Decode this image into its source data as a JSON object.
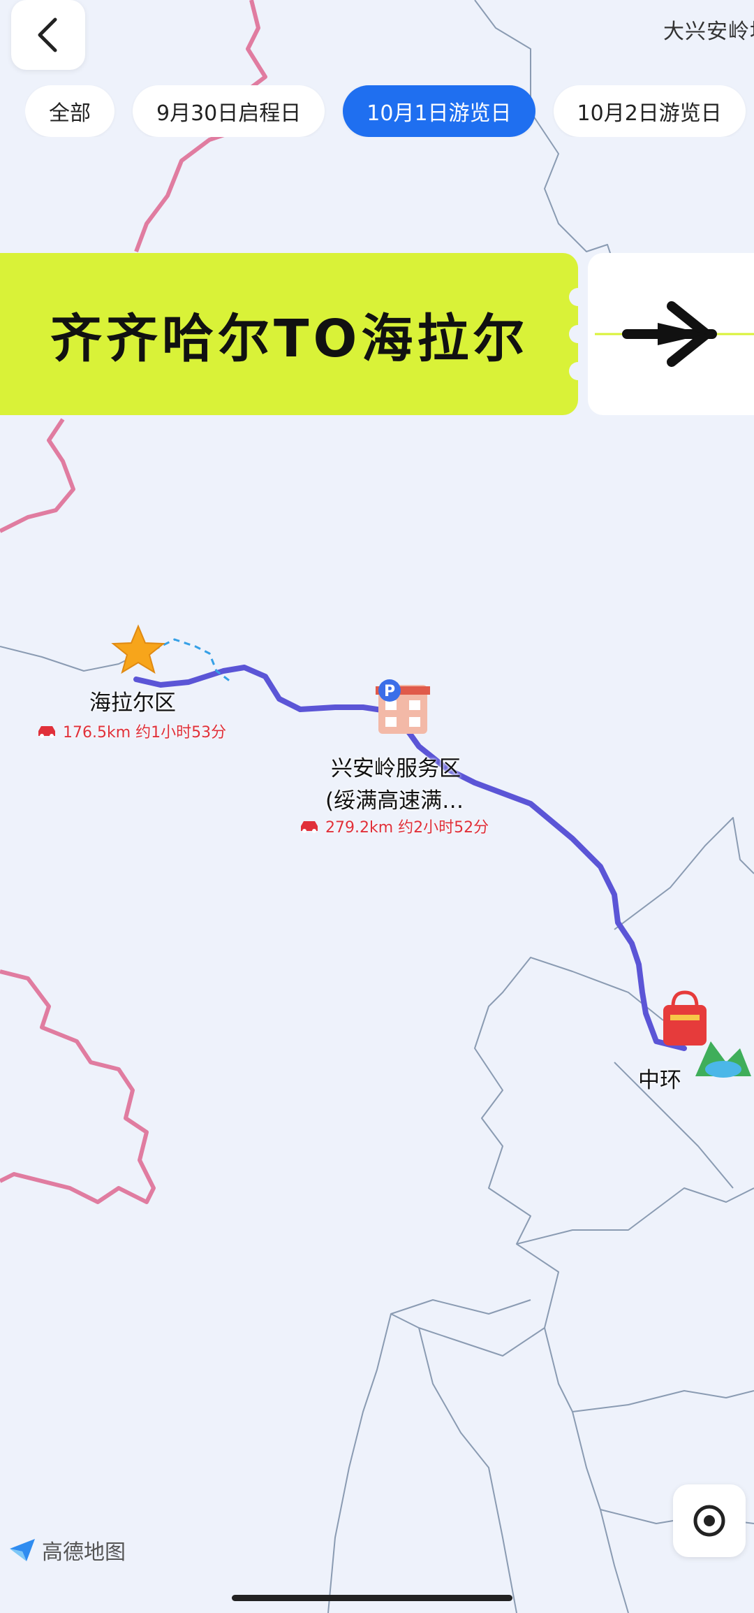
{
  "header": {
    "region_label": "大兴安岭地",
    "back_icon": "chevron-left-icon"
  },
  "tabs": [
    {
      "label": "全部",
      "active": false
    },
    {
      "label": "9月30日启程日",
      "active": false
    },
    {
      "label": "10月1日游览日",
      "active": true
    },
    {
      "label": "10月2日游览日",
      "active": false
    }
  ],
  "banner": {
    "title": "齐齐哈尔TO海拉尔",
    "arrow_icon": "airplane-icon",
    "color": "#d9f238"
  },
  "places": [
    {
      "name": "海拉尔区",
      "distance": "176.5km 约1小时53分",
      "icon": "star-icon"
    },
    {
      "name": "兴安岭服务区",
      "subname": "(绥满高速满…",
      "distance": "279.2km 约2小时52分",
      "icon": "service-area-icon"
    },
    {
      "name": "中环",
      "icon": "shopping-bag-icon"
    }
  ],
  "colors": {
    "route": "#5b55d6",
    "border": "#e07ca0",
    "accent": "#1f6ff0",
    "distance_text": "#e0303a"
  },
  "footer": {
    "logo_text": "高德地图",
    "locate_icon": "locate-icon"
  }
}
